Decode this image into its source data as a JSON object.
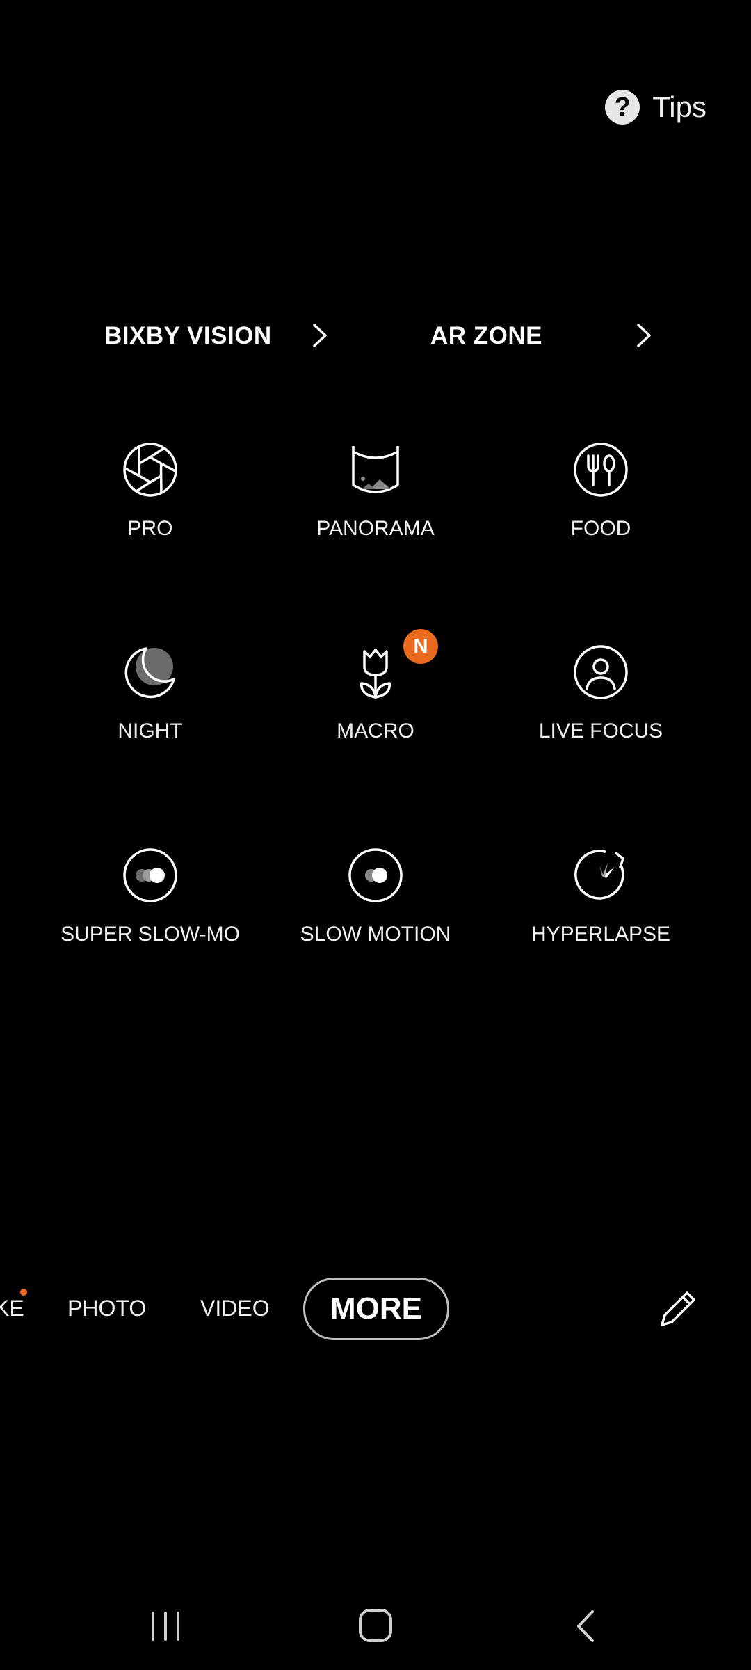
{
  "tips": {
    "label": "Tips",
    "icon": "help-circle-icon"
  },
  "shortcuts": [
    {
      "label": "BIXBY VISION",
      "icon": "chevron-right-icon"
    },
    {
      "label": "AR ZONE",
      "icon": "chevron-right-icon"
    }
  ],
  "modes": [
    {
      "label": "PRO",
      "icon": "aperture-icon"
    },
    {
      "label": "PANORAMA",
      "icon": "panorama-icon"
    },
    {
      "label": "FOOD",
      "icon": "food-icon"
    },
    {
      "label": "NIGHT",
      "icon": "moon-icon"
    },
    {
      "label": "MACRO",
      "icon": "flower-icon",
      "badge": "N"
    },
    {
      "label": "LIVE FOCUS",
      "icon": "person-focus-icon"
    },
    {
      "label": "SUPER SLOW-MO",
      "icon": "super-slow-mo-icon"
    },
    {
      "label": "SLOW MOTION",
      "icon": "slow-motion-icon"
    },
    {
      "label": "HYPERLAPSE",
      "icon": "hyperlapse-icon"
    }
  ],
  "modebar": {
    "partial_item": "KE",
    "items": [
      "PHOTO",
      "VIDEO"
    ],
    "active": "MORE",
    "edit_icon": "pencil-icon"
  },
  "navbar": {
    "recents_icon": "recents-icon",
    "home_icon": "home-icon",
    "back_icon": "back-icon"
  },
  "colors": {
    "background": "#000000",
    "accent": "#ea6a1f",
    "text": "#ffffff"
  }
}
